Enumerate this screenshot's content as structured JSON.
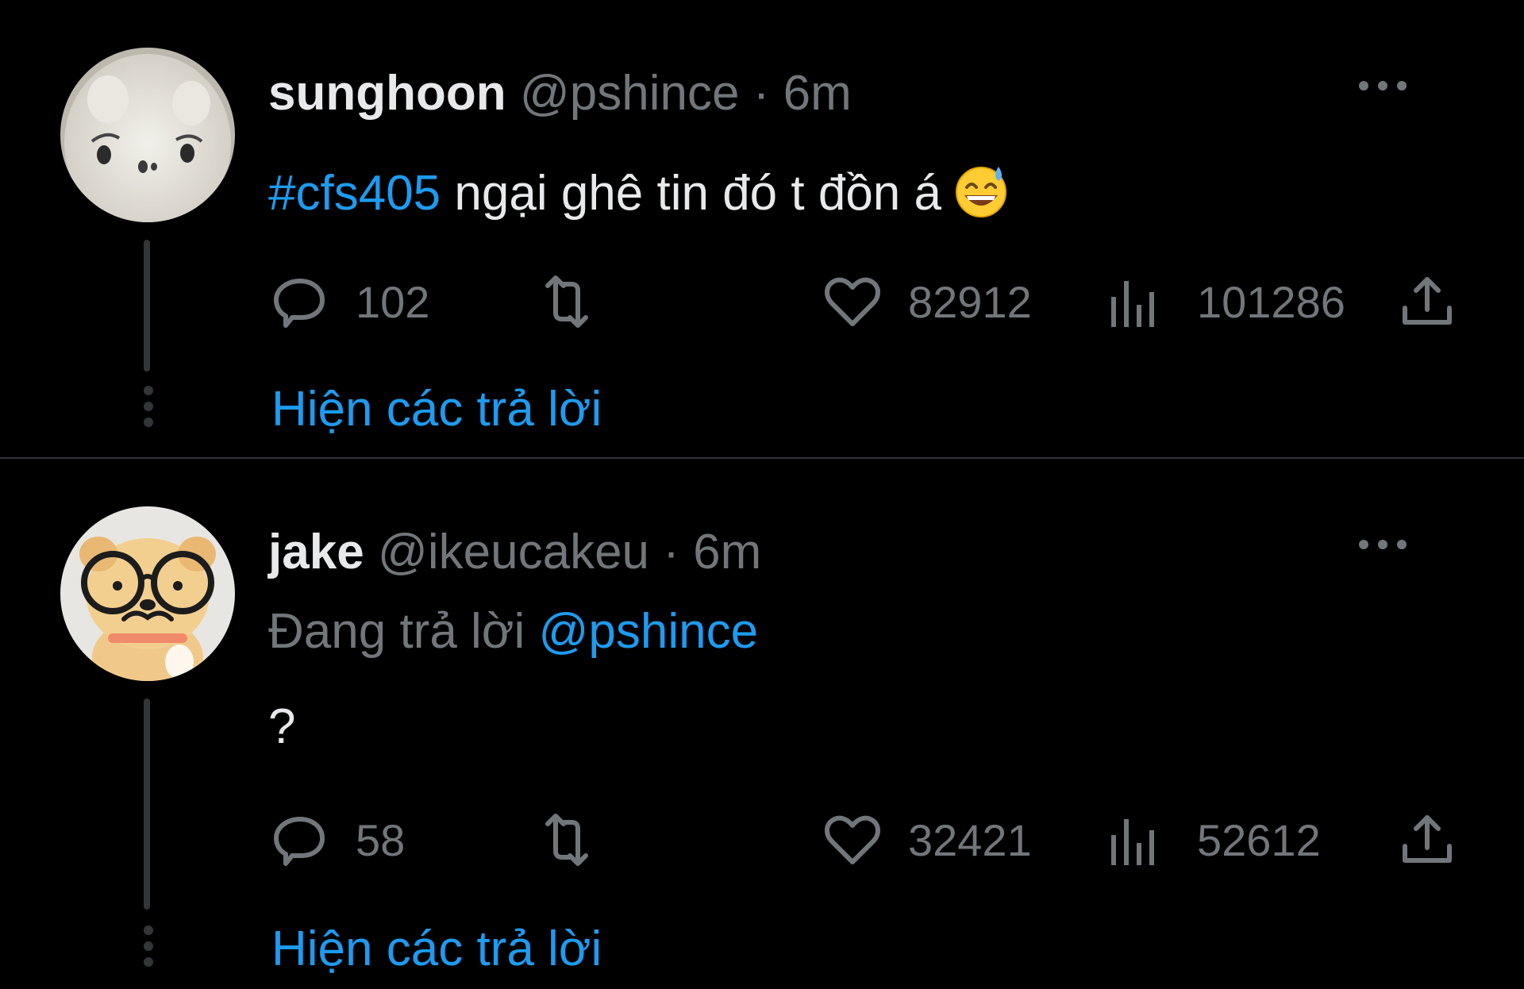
{
  "theme": {
    "background": "#000000",
    "text_primary": "#e7e9ea",
    "text_secondary": "#71767b",
    "accent": "#1d9bf0",
    "separator": "#2f3336"
  },
  "tweets": [
    {
      "display_name": "sunghoon",
      "handle": "@pshince",
      "dot": "·",
      "time": "6m",
      "hashtag": "#cfs405",
      "text": " ngại ghê tin đó t đồn á",
      "emoji": "grinning-face-with-sweat-emoji",
      "avatar": "white-plush-avatar",
      "actions": {
        "replies": "102",
        "retweets": "",
        "likes": "82912",
        "views": "101286"
      },
      "show_replies_label": "Hiện các trả lời"
    },
    {
      "display_name": "jake",
      "handle": "@ikeucakeu",
      "dot": "·",
      "time": "6m",
      "reply_prefix": "Đang trả lời ",
      "reply_mention": "@pshince",
      "text": "?",
      "avatar": "dog-plush-with-glasses-avatar",
      "actions": {
        "replies": "58",
        "retweets": "",
        "likes": "32421",
        "views": "52612"
      },
      "show_replies_label": "Hiện các trả lời"
    }
  ]
}
